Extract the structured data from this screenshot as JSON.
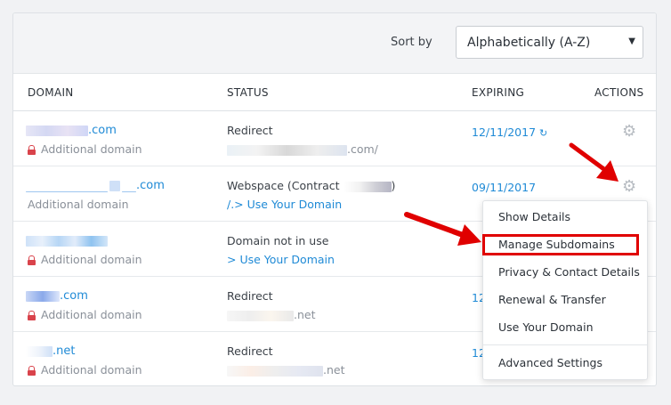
{
  "toolbar": {
    "sort_label": "Sort by",
    "sort_value": "Alphabetically (A-Z)"
  },
  "table": {
    "headers": {
      "domain": "DOMAIN",
      "status": "STATUS",
      "expiring": "EXPIRING",
      "actions": "ACTIONS"
    },
    "rows": [
      {
        "domain_suffix": ".com",
        "sub": "Additional domain",
        "locked": true,
        "status": "Redirect",
        "status_detail": ".com/",
        "expiry": "12/11/2017",
        "refresh": true
      },
      {
        "domain_suffix": ".com",
        "sub": "Additional domain",
        "locked": false,
        "status": "Webspace (Contract",
        "status_tail": ")",
        "status_detail": "/.> Use Your Domain",
        "expiry": "09/11/2017",
        "refresh": false
      },
      {
        "domain_suffix": "",
        "sub": "Additional domain",
        "locked": true,
        "status": "Domain not in use",
        "status_detail": "> Use Your Domain",
        "expiry": "",
        "refresh": false
      },
      {
        "domain_suffix": ".com",
        "sub": "Additional domain",
        "locked": true,
        "status": "Redirect",
        "status_detail": ".net",
        "expiry": "12",
        "refresh": false
      },
      {
        "domain_suffix": ".net",
        "sub": "Additional domain",
        "locked": true,
        "status": "Redirect",
        "status_detail": ".net",
        "expiry": "12",
        "refresh": false
      }
    ]
  },
  "menu": {
    "items": [
      "Show Details",
      "Manage Subdomains",
      "Privacy & Contact Details",
      "Renewal & Transfer",
      "Use Your Domain"
    ],
    "footer_item": "Advanced Settings",
    "highlighted": "Manage Subdomains"
  },
  "icons": {
    "gear": "gear-icon",
    "refresh": "refresh-icon",
    "lock": "lock-icon",
    "arrow": "red-arrow-icon"
  },
  "colors": {
    "link": "#1f8ad6",
    "lock": "#d9434b",
    "highlight": "#e00000",
    "arrow": "#e00000"
  }
}
